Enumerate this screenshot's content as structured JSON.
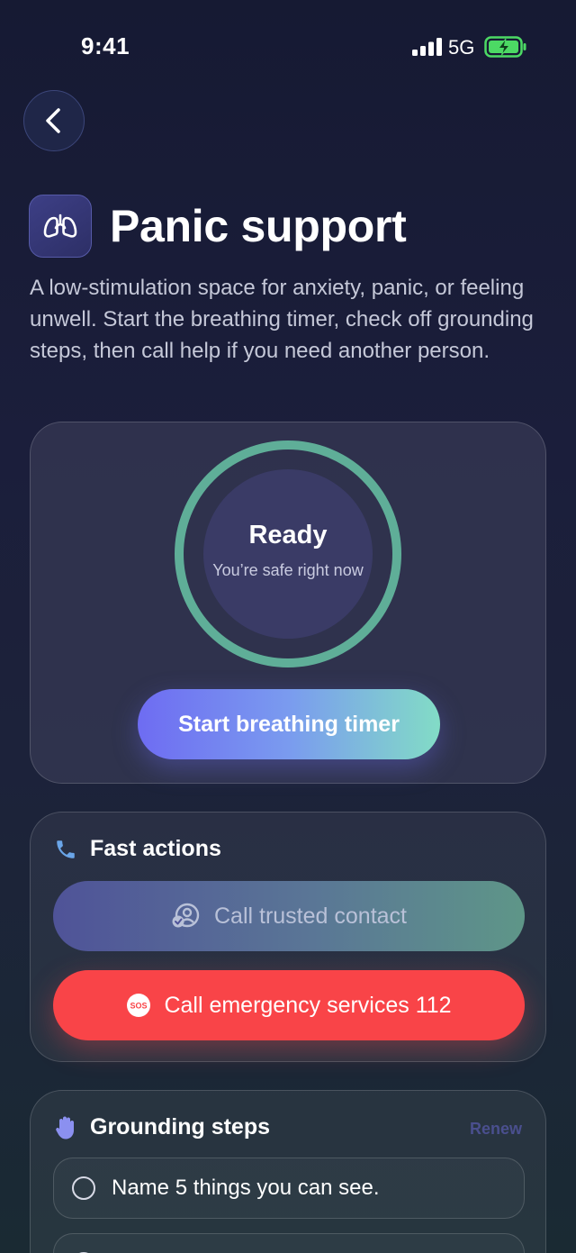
{
  "status_bar": {
    "time": "9:41",
    "network": "5G",
    "icons": [
      "signal-icon",
      "battery-charging-icon"
    ]
  },
  "header": {
    "back_icon": "chevron-left-icon",
    "title_icon": "lungs-icon",
    "title": "Panic support",
    "description": "A low-stimulation space for anxiety, panic, or feeling unwell. Start the breathing timer, check off grounding steps, then call help if you need another person."
  },
  "breathing": {
    "status": "Ready",
    "subtitle": "You’re safe right now",
    "start_label": "Start breathing timer",
    "ring_color": "#5fae98"
  },
  "fast_actions": {
    "icon": "phone-icon",
    "title": "Fast actions",
    "trusted_icon": "contact-check-icon",
    "trusted_label": "Call trusted contact",
    "emergency_icon": "sos-icon",
    "emergency_badge": "SOS",
    "emergency_label": "Call emergency services 112",
    "emergency_color": "#f94448"
  },
  "grounding": {
    "icon": "hand-icon",
    "title": "Grounding steps",
    "renew_label": "Renew",
    "steps": [
      {
        "label": "Name 5 things you can see.",
        "checked": false
      },
      {
        "label": "",
        "checked": false
      }
    ]
  },
  "colors": {
    "accent": "#6e6cf2",
    "accent_teal": "#82dcc6",
    "background": "#1b1e3b"
  }
}
